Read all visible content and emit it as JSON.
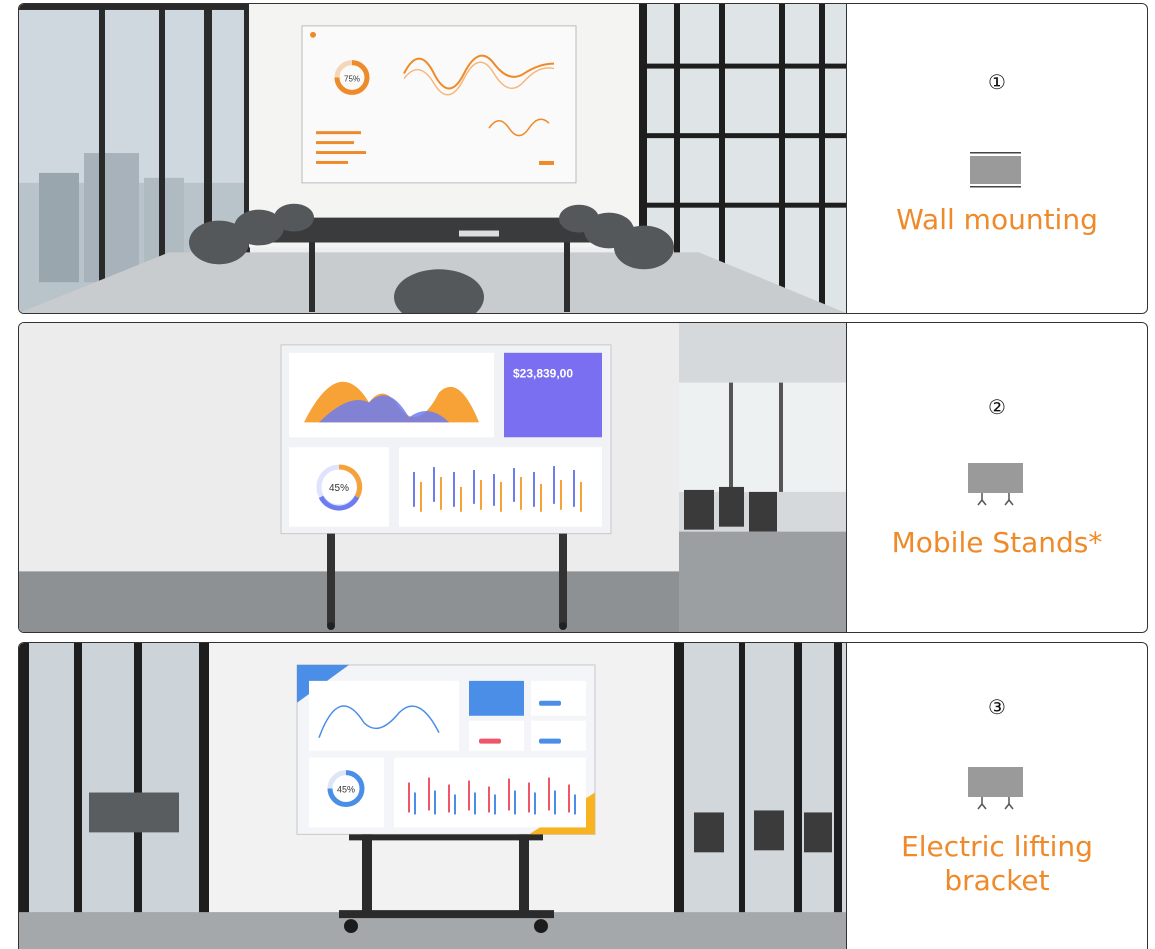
{
  "options": [
    {
      "number": "①",
      "label": "Wall mounting",
      "icon": "wall-mount-icon",
      "screen": {
        "gauge_percent": "75%"
      }
    },
    {
      "number": "②",
      "label": "Mobile Stands*",
      "icon": "mobile-stand-icon",
      "screen": {
        "amount": "$23,839,00",
        "gauge_percent": "45%"
      }
    },
    {
      "number": "③",
      "label_lines": [
        "Electric lifting",
        "bracket"
      ],
      "icon": "lifting-bracket-icon",
      "screen": {
        "gauge_percent": "45%"
      }
    }
  ],
  "colors": {
    "accent": "#ef8a2a",
    "icon_gray": "#9a9a9a",
    "border": "#333333"
  }
}
